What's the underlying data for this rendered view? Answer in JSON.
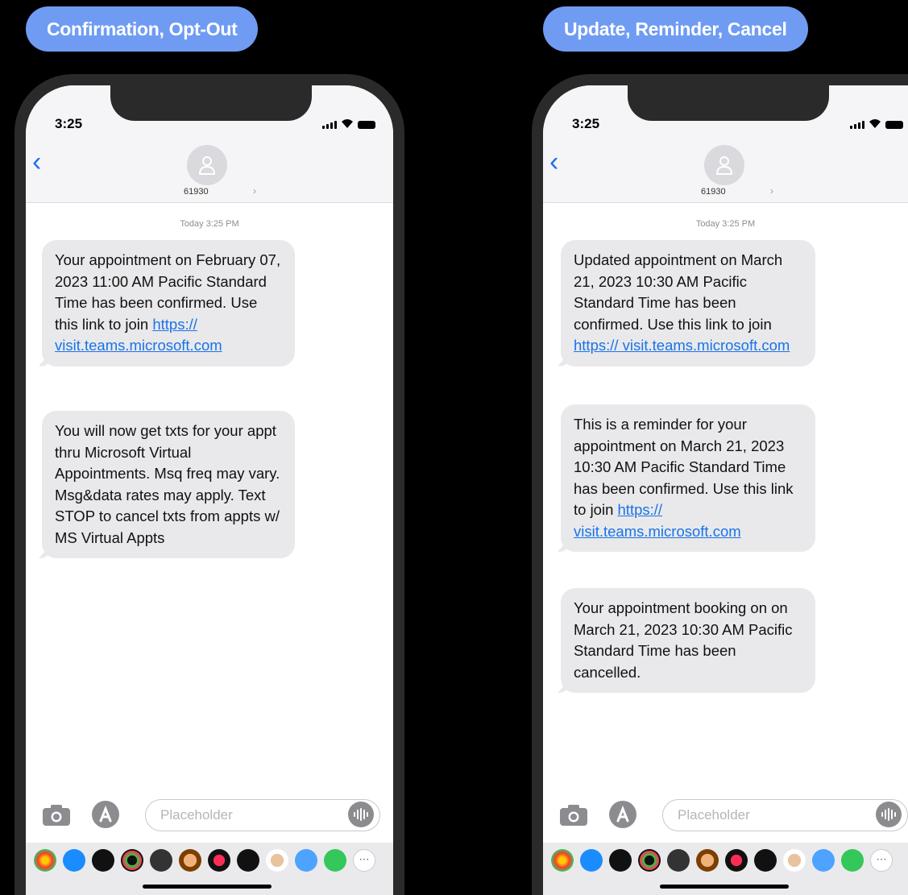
{
  "pills": {
    "left": "Confirmation, Opt-Out",
    "right": "Update, Reminder, Cancel"
  },
  "phone_left": {
    "time": "3:25",
    "contact": "61930",
    "date_stamp": "Today 3:25 PM",
    "messages": [
      {
        "text": "Your appointment on February 07, 2023 11:00 AM Pacific Standard Time has been confirmed. Use this link to join ",
        "link": "https:// visit.teams.microsoft.com"
      },
      {
        "text": "You will now get txts for your appt thru Microsoft Virtual Appointments. Msq freq may vary. Msg&data rates may apply. Text STOP to cancel txts from appts w/ MS Virtual Appts"
      }
    ],
    "input_placeholder": "Placeholder"
  },
  "phone_right": {
    "time": "3:25",
    "contact": "61930",
    "date_stamp": "Today 3:25 PM",
    "messages": [
      {
        "text": "Updated appointment on March 21, 2023 10:30 AM Pacific Standard Time has been confirmed. Use this link to join ",
        "link": "https:// visit.teams.microsoft.com"
      },
      {
        "text": "This is a reminder for your appointment on March 21, 2023 10:30 AM Pacific Standard Time has been confirmed. Use this link to join ",
        "link": "https:// visit.teams.microsoft.com"
      },
      {
        "text": "Your appointment booking on on March 21, 2023 10:30 AM Pacific Standard Time has been cancelled."
      }
    ],
    "input_placeholder": "Placeholder"
  },
  "colors": {
    "pill": "#6f9cf2",
    "bubble": "#e9e9eb",
    "link": "#1a73e8"
  },
  "app_icons": [
    "photos-icon",
    "app-store-icon",
    "apple-pay-icon",
    "fitness-icon",
    "memoji-icon",
    "animoji-icon",
    "digital-touch-icon",
    "memoji-sticker-icon",
    "app-store-icon",
    "music-icon",
    "more-icon"
  ]
}
